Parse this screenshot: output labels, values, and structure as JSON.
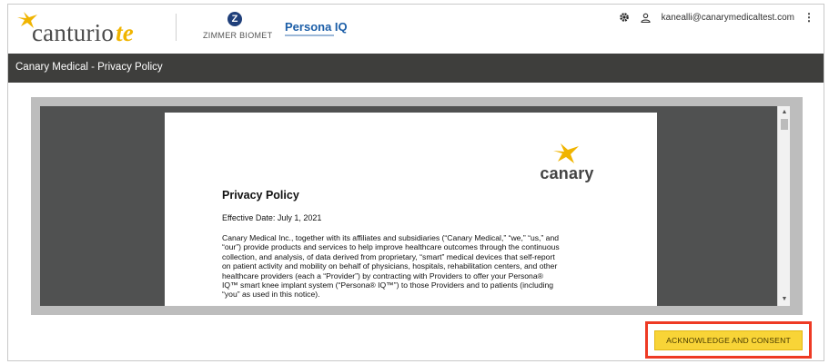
{
  "header": {
    "app_logo": {
      "name": "canturio",
      "suffix": "te"
    },
    "partner_brand": "ZIMMER BIOMET",
    "product_brand": {
      "name": "Persona",
      "suffix": " IQ"
    },
    "user_email": "kanealli@canarymedicaltest.com",
    "icons": [
      "gear-icon",
      "user-icon",
      "kebab-menu-icon"
    ]
  },
  "titlebar": {
    "title": "Canary Medical - Privacy Policy"
  },
  "document": {
    "logo_text": "canary",
    "title": "Privacy Policy",
    "effective_date": "Effective Date:  July 1, 2021",
    "body_lines": [
      "Canary Medical Inc., together with its affiliates and subsidiaries (“Canary Medical,” “we,” “us,” and",
      "“our”) provide products and services to help improve healthcare outcomes through the continuous",
      "collection, and analysis, of data derived from proprietary, “smart” medical devices that self-report",
      "on patient activity and mobility on behalf of physicians, hospitals, rehabilitation centers, and other",
      "healthcare providers (each a “Provider”) by contracting with Providers to offer your Persona®",
      "IQ™ smart knee implant system (“Persona® IQ™”) to those Providers and to patients (including",
      "“you” as used in this notice)."
    ]
  },
  "actions": {
    "consent_label": "ACKNOWLEDGE AND CONSENT"
  },
  "colors": {
    "accent_yellow": "#f8d437",
    "highlight_red": "#ee3a24",
    "titlebar_bg": "#3e3e3c",
    "brand_blue": "#1d5fa8"
  }
}
